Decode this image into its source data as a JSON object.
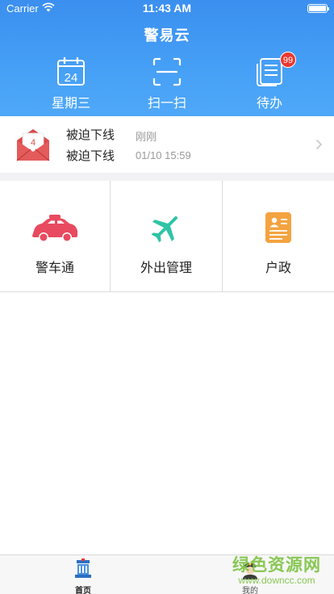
{
  "status_bar": {
    "carrier": "Carrier",
    "time": "11:43 AM"
  },
  "header": {
    "title": "警易云"
  },
  "quick_actions": [
    {
      "label": "星期三",
      "icon": "calendar-icon",
      "day": "24"
    },
    {
      "label": "扫一扫",
      "icon": "scan-icon"
    },
    {
      "label": "待办",
      "icon": "todo-document-icon",
      "badge": "99"
    }
  ],
  "message": {
    "icon": "envelope-icon",
    "icon_number": "4",
    "rows": [
      {
        "title": "被迫下线",
        "time": "刚刚"
      },
      {
        "title": "被迫下线",
        "time": "01/10 15:59"
      }
    ]
  },
  "apps": [
    {
      "label": "警车通",
      "icon": "police-car-icon",
      "color": "#e84a5f"
    },
    {
      "label": "外出管理",
      "icon": "airplane-icon",
      "color": "#2ec4a6"
    },
    {
      "label": "户政",
      "icon": "id-card-icon",
      "color": "#f4a340"
    }
  ],
  "tabbar": [
    {
      "label": "首页",
      "icon": "police-station-icon",
      "active": true
    },
    {
      "label": "我的",
      "icon": "police-officer-icon",
      "active": false
    }
  ],
  "watermark": {
    "text": "绿色资源网",
    "url": "www.downcc.com"
  },
  "colors": {
    "header_start": "#3b8fef",
    "header_end": "#4fa8f8",
    "badge": "#e8372f",
    "watermark": "#7dc242"
  }
}
